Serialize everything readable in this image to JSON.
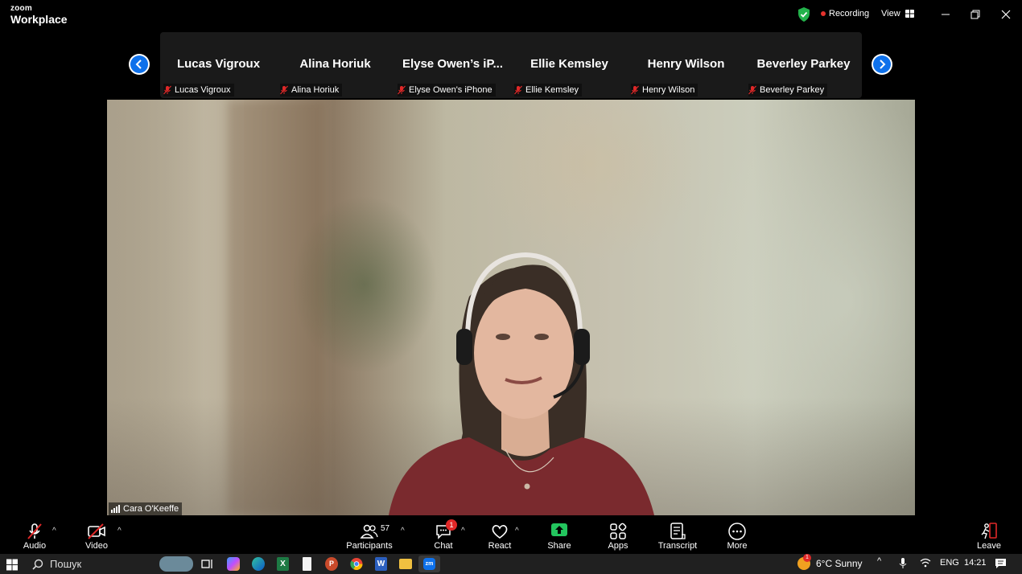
{
  "app": {
    "brand_top": "zoom",
    "brand_bottom": "Workplace"
  },
  "titlebar": {
    "recording_label": "Recording",
    "view_label": "View"
  },
  "gallery": {
    "tiles": [
      {
        "name": "Lucas Vigroux",
        "label": "Lucas Vigroux"
      },
      {
        "name": "Alina Horiuk",
        "label": "Alina Horiuk"
      },
      {
        "name": "Elyse Owen’s iP...",
        "label": "Elyse Owen's iPhone"
      },
      {
        "name": "Ellie Kemsley",
        "label": "Ellie Kemsley"
      },
      {
        "name": "Henry Wilson",
        "label": "Henry Wilson"
      },
      {
        "name": "Beverley Parkey",
        "label": "Beverley Parkey"
      }
    ]
  },
  "main_video": {
    "speaker_name": "Cara O'Keeffe"
  },
  "toolbar": {
    "audio": "Audio",
    "video": "Video",
    "participants": "Participants",
    "participants_count": "57",
    "chat": "Chat",
    "chat_badge": "1",
    "react": "React",
    "share": "Share",
    "apps": "Apps",
    "transcript": "Transcript",
    "more": "More",
    "leave": "Leave"
  },
  "taskbar": {
    "search_placeholder": "Пошук",
    "weather_badge": "1",
    "weather": "6°C Sunny",
    "language": "ENG",
    "time": "14:21"
  },
  "colors": {
    "accent_blue": "#0e71eb",
    "share_green": "#23c55e",
    "muted_red": "#e02828",
    "leave_red": "#e02828"
  }
}
